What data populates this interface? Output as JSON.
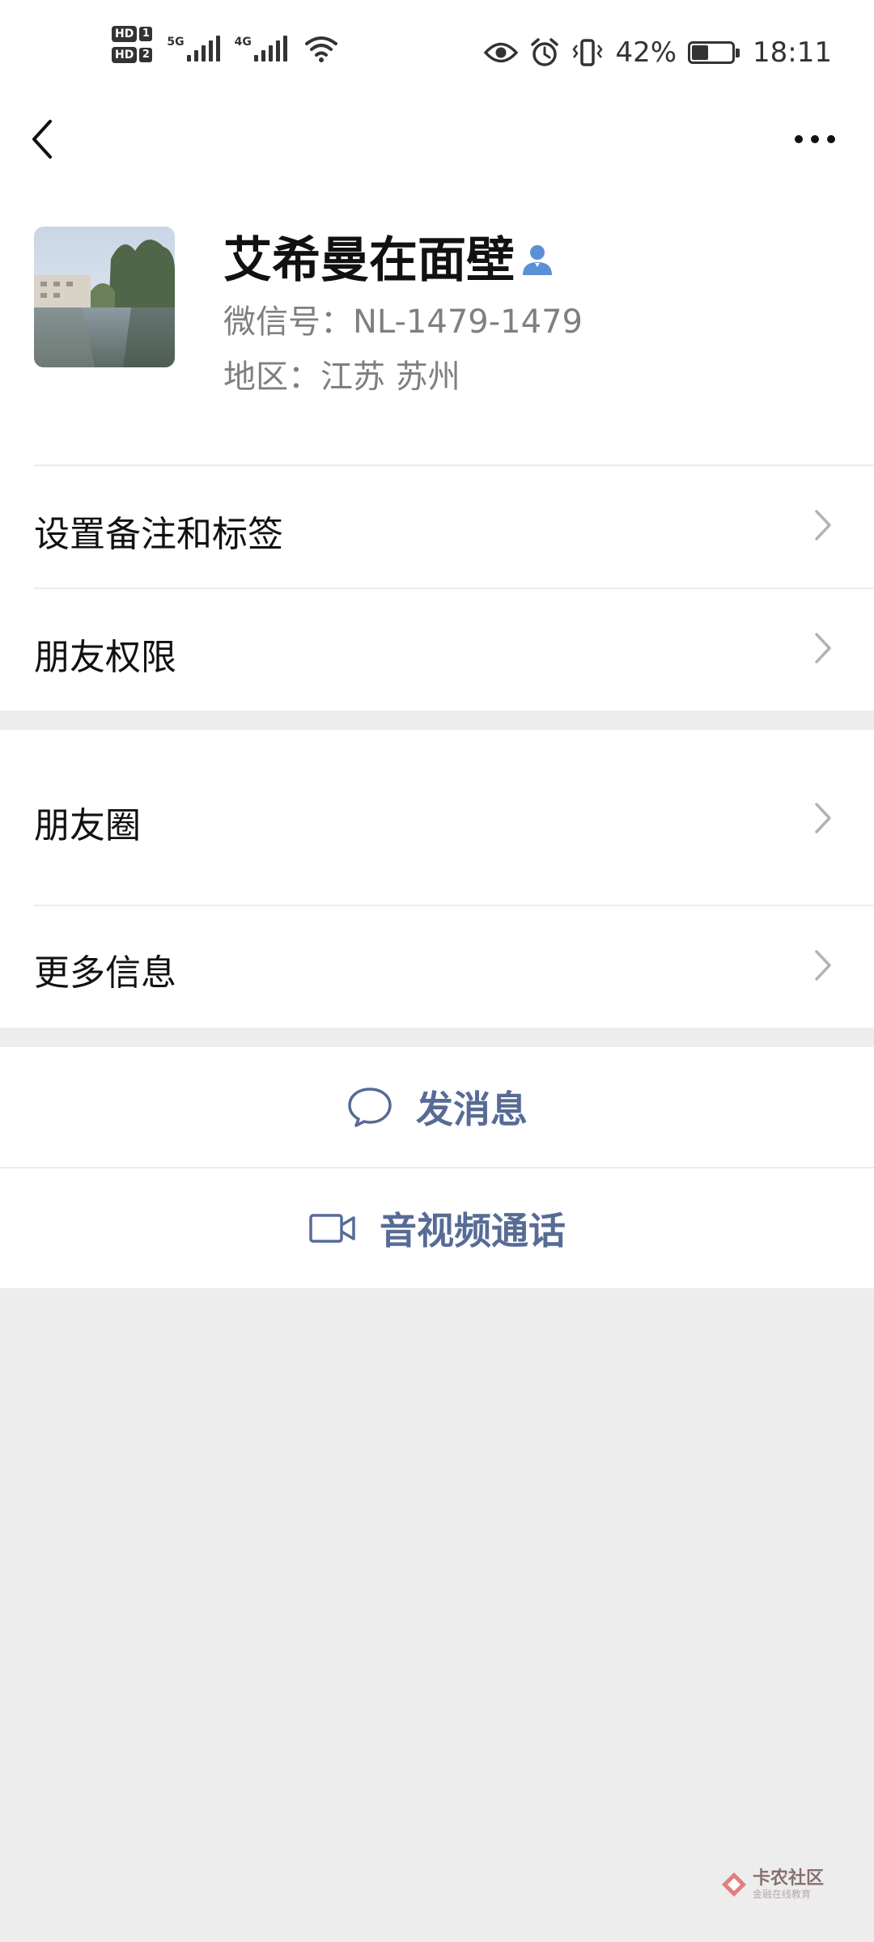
{
  "status_bar": {
    "sim1_label": "HD",
    "sim1_num": "1",
    "sim2_label": "HD",
    "sim2_num": "2",
    "net1_label": "5G",
    "net2_label": "4G",
    "battery_percent_text": "42%",
    "battery_level": 0.42,
    "time": "18:11",
    "icons": [
      "signal-icon",
      "wifi-icon",
      "eye-icon",
      "alarm-icon",
      "vibrate-icon",
      "battery-icon"
    ]
  },
  "nav": {
    "back_icon": "back-arrow-icon",
    "more_icon": "more-icon"
  },
  "profile": {
    "name": "艾希曼在面壁",
    "wechat_id": "微信号：NL-1479-1479",
    "region": "地区：江苏  苏州",
    "badge_icon": "person-icon"
  },
  "menu": {
    "remark_tags": "设置备注和标签",
    "friend_permissions": "朋友权限",
    "moments": "朋友圈",
    "more_info": "更多信息"
  },
  "actions": {
    "send_message": "发消息",
    "av_call": "音视频通话"
  },
  "watermark": {
    "title": "卡农社区",
    "subtitle": "金融在线教育"
  },
  "colors": {
    "link_blue": "#576b95",
    "background_gray": "#ededed",
    "badge_blue": "#5b8fd8"
  }
}
